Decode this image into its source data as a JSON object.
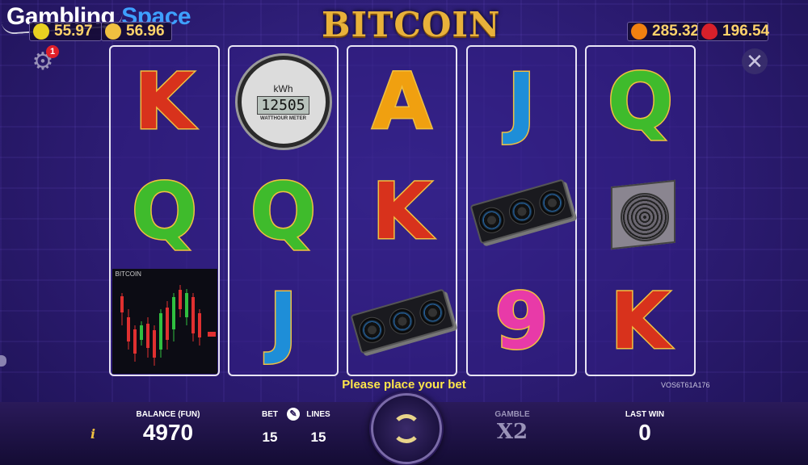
{
  "header": {
    "brand_main": "Gambling ",
    "brand_accent": "Space",
    "game_title": "BITCOIN",
    "jackpots": [
      {
        "value": "55.97",
        "icon": "lemon-icon",
        "color": "#e8d020"
      },
      {
        "value": "56.96",
        "icon": "coin-icon",
        "color": "#f0c040"
      },
      {
        "value": "285.32",
        "icon": "orange-icon",
        "color": "#f08010"
      },
      {
        "value": "196.54",
        "icon": "strawberry-icon",
        "color": "#d8202a"
      }
    ],
    "notification_count": "1"
  },
  "reels": [
    [
      "K",
      "Q",
      "chart"
    ],
    [
      "meter",
      "Q",
      "J"
    ],
    [
      "A",
      "K",
      "gpu"
    ],
    [
      "J",
      "gpu",
      "9"
    ],
    [
      "Q",
      "miner",
      "K"
    ]
  ],
  "symbols": {
    "meter": {
      "unit": "kWh",
      "reading": "12505",
      "brand": "WATTHOUR METER"
    },
    "chart": {
      "label": "BITCOIN"
    }
  },
  "message": "Please place your bet",
  "version": "VOS6T61A176",
  "bottom": {
    "info": "i",
    "balance_label": "BALANCE (FUN)",
    "balance_value": "4970",
    "bet_label": "BET",
    "bet_value": "15",
    "lines_label": "LINES",
    "lines_value": "15",
    "gamble_label": "GAMBLE",
    "gamble_value": "X2",
    "lastwin_label": "LAST WIN",
    "lastwin_value": "0"
  }
}
